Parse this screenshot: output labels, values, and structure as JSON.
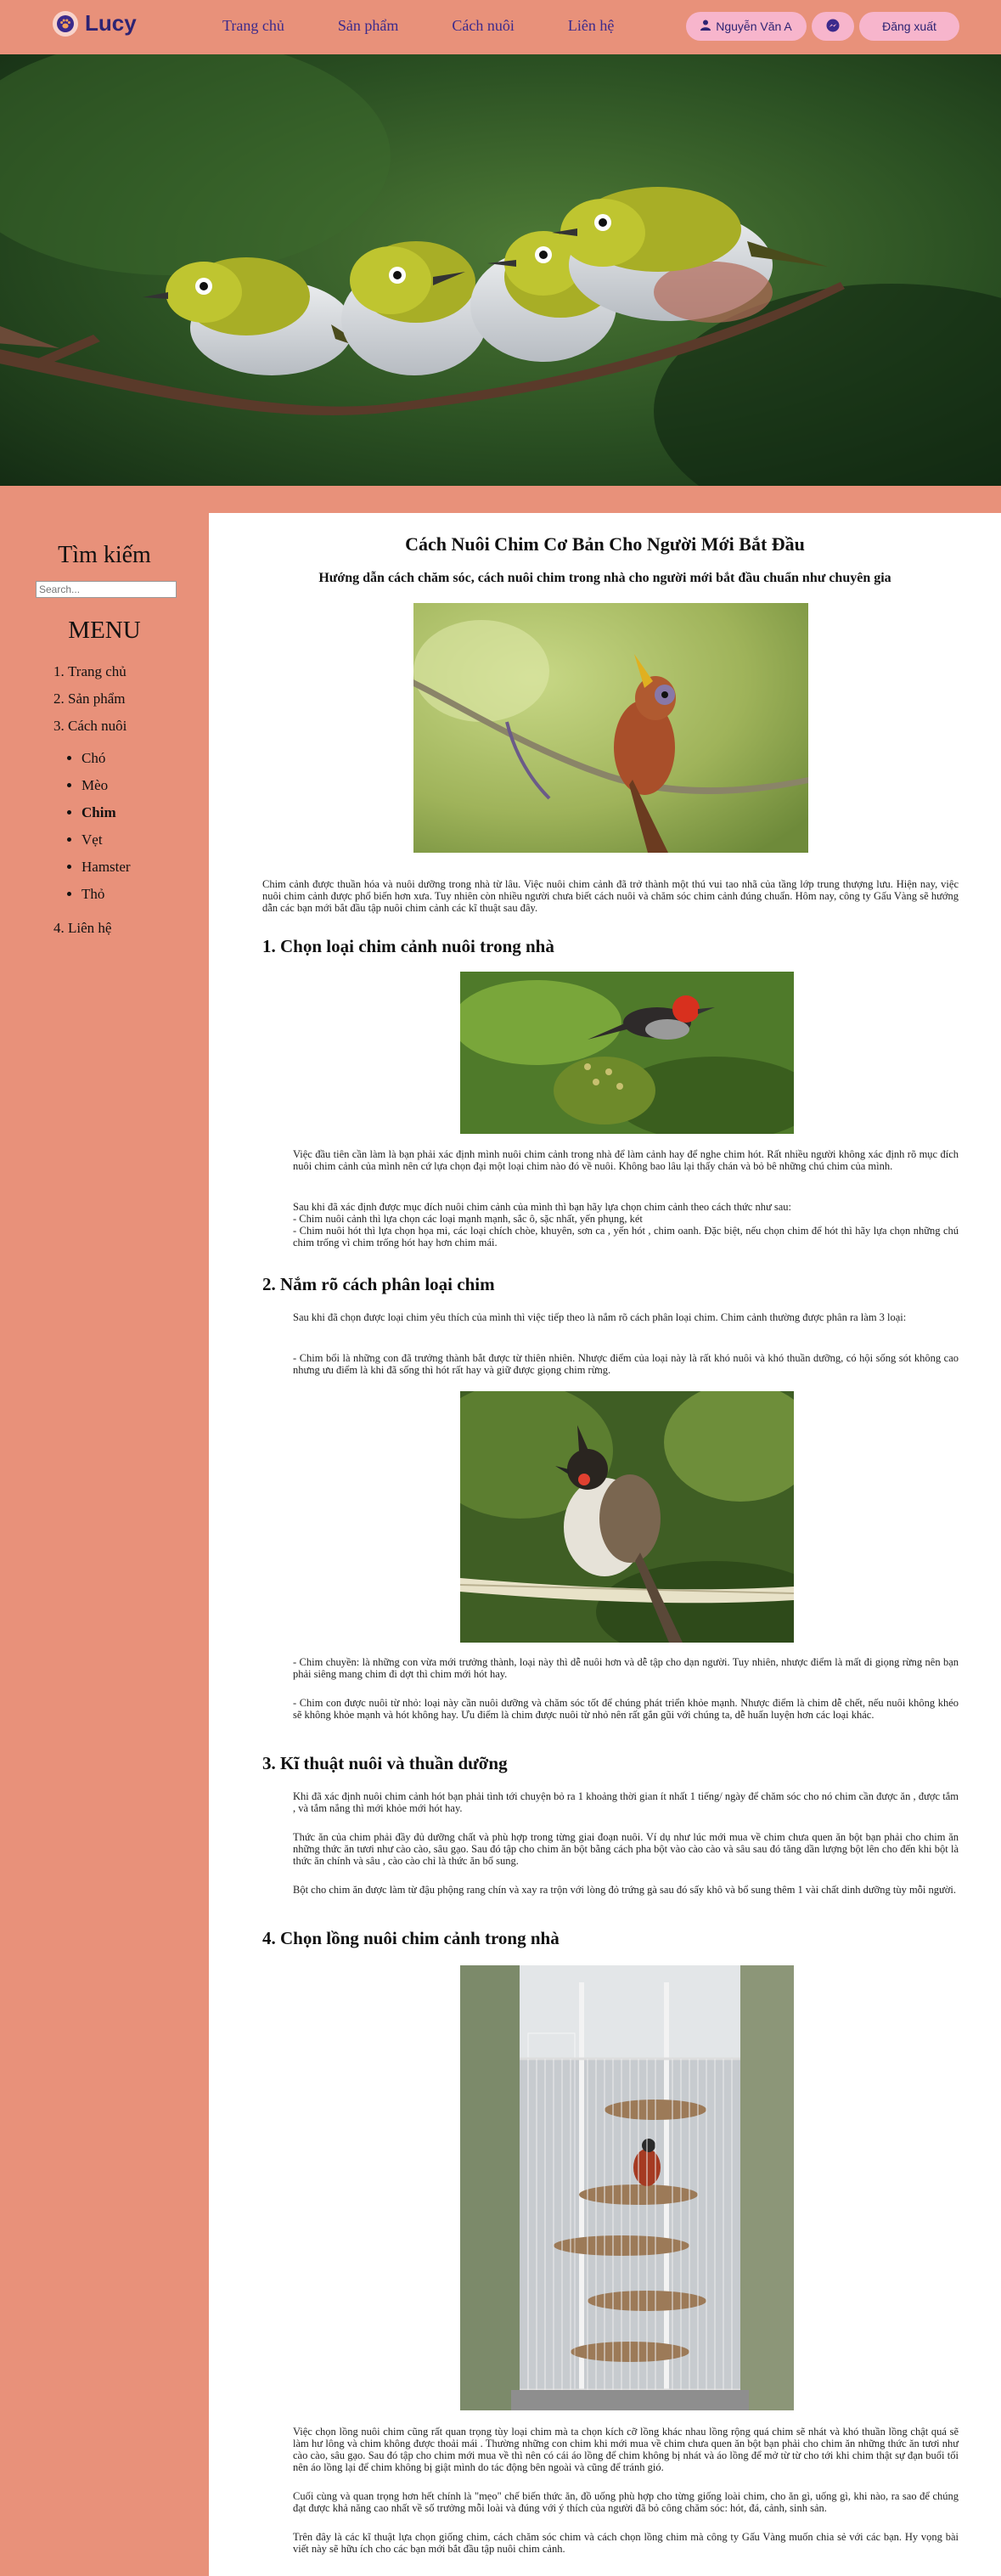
{
  "header": {
    "logo_text": "Lucy",
    "nav": [
      "Trang chủ",
      "Sản phẩm",
      "Cách nuôi",
      "Liên hệ"
    ],
    "user_name": "Nguyễn Văn A",
    "logout": "Đăng xuất"
  },
  "sidebar": {
    "search_title": "Tìm kiếm",
    "search_placeholder": "Search...",
    "menu_title": "MENU",
    "menu": [
      "Trang chủ",
      "Sản phẩm",
      "Cách nuôi",
      "Liên hệ"
    ],
    "submenu": [
      "Chó",
      "Mèo",
      "Chim",
      "Vẹt",
      "Hamster",
      "Thỏ"
    ],
    "active_submenu": "Chim"
  },
  "article": {
    "title": "Cách Nuôi Chim Cơ Bản Cho Người Mới Bắt Đầu",
    "subtitle": "Hướng dẫn cách chăm sóc, cách nuôi chim trong nhà cho người mới bắt đầu chuẩn như chuyên gia",
    "intro": "Chim cảnh được thuần hóa và nuôi dưỡng trong nhà từ lâu. Việc nuôi chim cảnh đã trở thành một thú vui tao nhã của tầng lớp trung thượng lưu. Hiện nay, việc nuôi chim cảnh được phổ biến hơn xưa. Tuy nhiên còn nhiều người chưa biết cách nuôi và chăm sóc chim cảnh đúng chuẩn. Hôm nay, công ty Gấu Vàng sẽ hướng dẫn các bạn mới bắt đầu tập nuôi chim cảnh các kĩ thuật sau đây.",
    "s1_title": "1. Chọn loại chim cảnh nuôi trong nhà",
    "s1_p1": "Việc đầu tiên cần làm là bạn phải xác định mình nuôi chim cảnh trong nhà để làm cảnh hay để nghe chim hót. Rất nhiều người không xác định rõ mục đích nuôi chim cảnh của mình nên cứ lựa chọn đại một loại chim nào đó về nuôi. Không bao lâu lại thấy chán và bỏ bê những chú chim của mình.",
    "s1_p2a": "Sau khi đã xác định được mục đích nuôi chim cảnh của mình thì bạn hãy lựa chọn chim cảnh theo cách thức như sau:",
    "s1_p2b": "- Chim nuôi cảnh thì lựa chọn các loại mạnh mạnh, sắc ô, sặc nhất, yến phụng, két",
    "s1_p2c": "- Chim nuôi hót thì lựa chọn họa mi, các loại chích chòe, khuyên, sơn ca , yến hót , chim oanh. Đặc biệt, nếu chọn chim để hót thì hãy lựa chọn những chú chim trống vì chim trống hót hay hơn chim mái.",
    "s2_title": "2. Nắm rõ cách phân loại chim",
    "s2_p1": "Sau khi đã chọn được loại chim yêu thích của mình thì việc tiếp theo là nắm rõ cách phân loại chim. Chim cảnh thường được phân ra làm 3 loại:",
    "s2_p2": "- Chim bổi là những con đã trưởng thành bắt được từ thiên nhiên. Nhược điểm của loại này là rất khó nuôi và khó thuần dưỡng, có hội sống sót không cao nhưng ưu điểm là khi đã sống thì hót rất hay và giữ được giọng chim rừng.",
    "s2_p3": "- Chim chuyền: là những con vừa mới trưởng thành, loại này thì dễ nuôi hơn và dễ tập cho dạn người. Tuy nhiên, nhược điểm là mất đi giọng rừng nên bạn phải siêng mang chim đi dợt thì chim mới hót hay.",
    "s2_p4": "- Chim con được nuôi từ nhỏ: loại này cần nuôi dưỡng và chăm sóc tốt để chúng phát triển khỏe mạnh. Nhược điểm là chim dễ chết, nếu nuôi không khéo sẽ không khỏe mạnh và hót không hay. Ưu điểm là chim được nuôi từ nhỏ nên rất gắn gũi với chúng ta, dễ huấn luyện hơn các loại khác.",
    "s3_title": "3. Kĩ thuật nuôi và thuần dưỡng",
    "s3_p1": "Khi đã xác định nuôi chim cảnh hót bạn phải tình tới chuyện bỏ ra 1 khoảng thời gian ít nhất 1 tiếng/ ngày để chăm sóc cho nó chim cần được ăn , được tắm , và tắm nắng thì mới khỏe mới hót hay.",
    "s3_p2": "Thức ăn của chim phải đầy đủ dưỡng chất và phù hợp trong từng giai đoạn nuôi. Ví dụ như lúc mới mua về chim chưa quen ăn bột bạn phải cho chim ăn những thức ăn tươi như cào cào, sâu gạo. Sau đó tập cho chim ăn bột bằng cách pha bột vào cào cào và sâu sau đó tăng dần lượng bột lên cho đến khi bột là thức ăn chính và sâu , cào cào chỉ là thức ăn bổ sung.",
    "s3_p3": "Bột cho chim ăn được làm từ đậu phộng rang chín và xay ra trộn với lòng đỏ trứng gà sau đó sấy khô và bổ sung thêm 1 vài chất dinh dưỡng tùy mỗi người.",
    "s4_title": "4. Chọn lồng nuôi chim cảnh trong nhà",
    "s4_p1": "Việc chọn lồng nuôi chim cũng rất quan trọng tùy loại chim mà ta chọn kích cỡ lồng khác nhau lồng rộng quá chim sẽ nhát và khó thuần lồng chật quá sẽ làm hư lông và chim không được thoải mái . Thường những con chim khi mới mua về chim chưa quen ăn bột bạn phải cho chim ăn những thức ăn tươi như cào cào, sâu gạo. Sau đó tập cho chim mới mua về thì nên có cái áo lồng để chim không bị nhát và áo lồng để mở từ từ cho tới khi chim thật sự đạn buổi tối nên áo lồng lại để chim không bị giật mình do tác động bên ngoài và cũng để tránh gió.",
    "s4_p2": "Cuối cùng và quan trọng hơn hết chính là \"mẹo\" chế biến thức ăn, đồ uống phù hợp cho từng giống loài chim, cho ăn gì, uống gì, khi nào, ra sao để chúng đạt được khả năng cao nhất về số trưởng mỗi loài và đúng với ý thích của người đã bỏ công chăm sóc: hót, đá, cảnh, sinh sản.",
    "s4_p3": "Trên đây là các kĩ thuật lựa chọn giống chim, cách chăm sóc chim và cách chọn lồng chim mà công ty Gấu Vàng muốn chia sẻ với các bạn. Hy vọng bài viết này sẽ hữu ích cho các bạn mới bắt đầu tập nuôi chim cảnh."
  }
}
